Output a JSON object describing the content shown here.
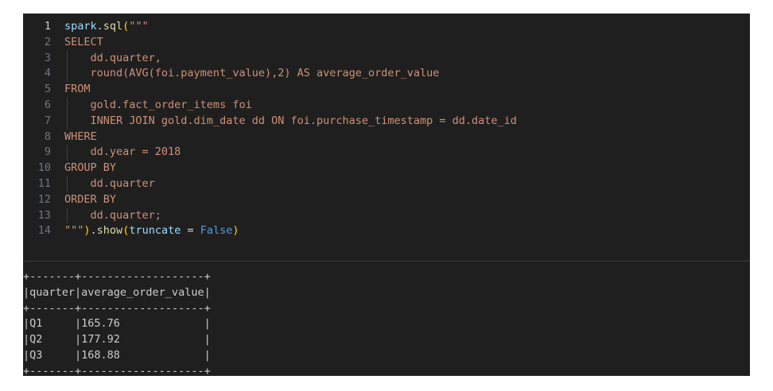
{
  "editor": {
    "active_line": 1,
    "lines": [
      {
        "n": "1",
        "tokens": [
          {
            "t": "spark",
            "c": "t-ident"
          },
          {
            "t": ".",
            "c": "t-white"
          },
          {
            "t": "sql",
            "c": "t-func"
          },
          {
            "t": "(",
            "c": "t-paren"
          },
          {
            "t": "\"\"\"",
            "c": "t-str"
          }
        ]
      },
      {
        "n": "2",
        "tokens": [
          {
            "t": "SELECT",
            "c": "t-str"
          }
        ]
      },
      {
        "n": "3",
        "guide": true,
        "tokens": [
          {
            "t": "    dd.quarter,",
            "c": "t-str"
          }
        ]
      },
      {
        "n": "4",
        "guide": true,
        "tokens": [
          {
            "t": "    round(AVG(foi.payment_value),2) AS average_order_value",
            "c": "t-str"
          }
        ]
      },
      {
        "n": "5",
        "tokens": [
          {
            "t": "FROM",
            "c": "t-str"
          }
        ]
      },
      {
        "n": "6",
        "guide": true,
        "tokens": [
          {
            "t": "    gold.fact_order_items foi",
            "c": "t-str"
          }
        ]
      },
      {
        "n": "7",
        "guide": true,
        "tokens": [
          {
            "t": "    INNER JOIN gold.dim_date dd ON foi.purchase_timestamp = dd.date_id",
            "c": "t-str"
          }
        ]
      },
      {
        "n": "8",
        "tokens": [
          {
            "t": "WHERE",
            "c": "t-str"
          }
        ]
      },
      {
        "n": "9",
        "guide": true,
        "tokens": [
          {
            "t": "    dd.year = 2018",
            "c": "t-str"
          }
        ]
      },
      {
        "n": "10",
        "tokens": [
          {
            "t": "GROUP BY",
            "c": "t-str"
          }
        ]
      },
      {
        "n": "11",
        "guide": true,
        "tokens": [
          {
            "t": "    dd.quarter",
            "c": "t-str"
          }
        ]
      },
      {
        "n": "12",
        "tokens": [
          {
            "t": "ORDER BY",
            "c": "t-str"
          }
        ]
      },
      {
        "n": "13",
        "guide": true,
        "tokens": [
          {
            "t": "    dd.quarter;",
            "c": "t-str"
          }
        ]
      },
      {
        "n": "14",
        "tokens": [
          {
            "t": "\"\"\"",
            "c": "t-str"
          },
          {
            "t": ")",
            "c": "t-paren"
          },
          {
            "t": ".",
            "c": "t-white"
          },
          {
            "t": "show",
            "c": "t-func"
          },
          {
            "t": "(",
            "c": "t-paren"
          },
          {
            "t": "truncate",
            "c": "t-ident"
          },
          {
            "t": " = ",
            "c": "t-white"
          },
          {
            "t": "False",
            "c": "t-kw"
          },
          {
            "t": ")",
            "c": "t-paren"
          }
        ]
      }
    ]
  },
  "output": {
    "text": "+-------+-------------------+\n|quarter|average_order_value|\n+-------+-------------------+\n|Q1     |165.76             |\n|Q2     |177.92             |\n|Q3     |168.88             |\n+-------+-------------------+"
  },
  "colors": {
    "background": "#1f1f1f",
    "string": "#ce9178",
    "identifier": "#9cdcfe",
    "function": "#dcdcaa",
    "bracket": "#ffd700",
    "keyword": "#569cd6",
    "line_number": "#6e7681"
  }
}
